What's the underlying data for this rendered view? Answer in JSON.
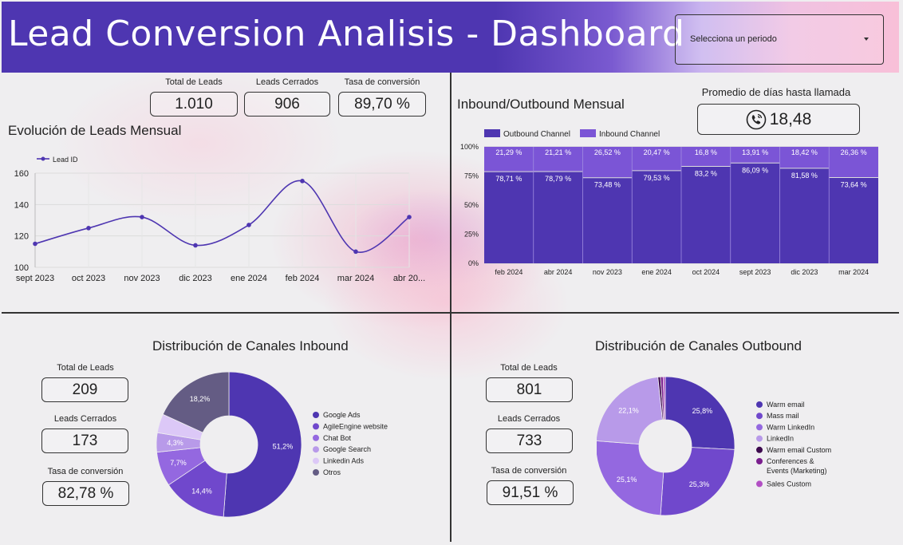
{
  "header": {
    "title": "Lead Conversion Analisis - Dashboard"
  },
  "period_select": {
    "placeholder": "Selecciona un periodo"
  },
  "top_kpis": [
    {
      "label": "Total de Leads",
      "value": "1.010"
    },
    {
      "label": "Leads Cerrados",
      "value": "906"
    },
    {
      "label": "Tasa de conversión",
      "value": "89,70 %"
    }
  ],
  "avg_days": {
    "label": "Promedio de días hasta llamada",
    "value": "18,48",
    "icon": "phone-call-icon"
  },
  "inbound_kpis": [
    {
      "label": "Total de Leads",
      "value": "209"
    },
    {
      "label": "Leads Cerrados",
      "value": "173"
    },
    {
      "label": "Tasa de conversión",
      "value": "82,78 %"
    }
  ],
  "outbound_kpis": [
    {
      "label": "Total de Leads",
      "value": "801"
    },
    {
      "label": "Leads Cerrados",
      "value": "733"
    },
    {
      "label": "Tasa de conversión",
      "value": "91,51 %"
    }
  ],
  "colors": {
    "header": "#4e36b1",
    "outbound": "#4e36b1",
    "inbound": "#7b55d6"
  },
  "chart_data": [
    {
      "id": "leads-line",
      "type": "line",
      "title": "Evolución de Leads Mensual",
      "x": [
        "sept 2023",
        "oct 2023",
        "nov 2023",
        "dic 2023",
        "ene 2024",
        "feb 2024",
        "mar 2024",
        "abr 20..."
      ],
      "series": [
        {
          "name": "Lead ID",
          "values": [
            115,
            125,
            132,
            114,
            127,
            155,
            110,
            132
          ],
          "color": "#4e36b1"
        }
      ],
      "ylim": [
        100,
        160
      ],
      "yticks": [
        100,
        120,
        140,
        160
      ],
      "grid": true,
      "legend": "top-left"
    },
    {
      "id": "io-bar",
      "type": "bar",
      "stacked": "percent",
      "title": "Inbound/Outbound Mensual",
      "categories": [
        "feb 2024",
        "abr 2024",
        "nov 2023",
        "ene 2024",
        "oct 2024",
        "sept 2023",
        "dic 2023",
        "mar 2024"
      ],
      "series": [
        {
          "name": "Outbound Channel",
          "values": [
            78.71,
            78.79,
            73.48,
            79.53,
            83.2,
            86.09,
            81.58,
            73.64
          ],
          "labels": [
            "78,71 %",
            "78,79 %",
            "73,48 %",
            "79,53 %",
            "83,2 %",
            "86,09 %",
            "81,58 %",
            "73,64 %"
          ],
          "color": "#4e36b1"
        },
        {
          "name": "Inbound Channel",
          "values": [
            21.29,
            21.21,
            26.52,
            20.47,
            16.8,
            13.91,
            18.42,
            26.36
          ],
          "labels": [
            "21,29 %",
            "21,21 %",
            "26,52 %",
            "20,47 %",
            "16,8 %",
            "13,91 %",
            "18,42 %",
            "26,36 %"
          ],
          "color": "#7b55d6"
        }
      ],
      "yticks": [
        "0%",
        "25%",
        "50%",
        "75%",
        "100%"
      ],
      "legend": "top-left"
    },
    {
      "id": "inbound-donut",
      "type": "pie",
      "donut": true,
      "title": "Distribución de Canales Inbound",
      "slices": [
        {
          "name": "Google Ads",
          "value": 51.2,
          "label": "51,2%",
          "color": "#4e36b1"
        },
        {
          "name": "AgileEngine website",
          "value": 14.4,
          "label": "14,4%",
          "color": "#7048cc"
        },
        {
          "name": "Chat Bot",
          "value": 7.7,
          "label": "7,7%",
          "color": "#9468e0"
        },
        {
          "name": "Google Search",
          "value": 4.3,
          "label": "4,3%",
          "color": "#b89ae9"
        },
        {
          "name": "Linkedin Ads",
          "value": 4.2,
          "label": "",
          "color": "#dcc8f7"
        },
        {
          "name": "Otros",
          "value": 18.2,
          "label": "18,2%",
          "color": "#645c84"
        }
      ],
      "legend": "right"
    },
    {
      "id": "outbound-donut",
      "type": "pie",
      "donut": true,
      "title": "Distribución de Canales Outbound",
      "slices": [
        {
          "name": "Warm email",
          "value": 25.8,
          "label": "25,8%",
          "color": "#4e36b1"
        },
        {
          "name": "Mass mail",
          "value": 25.3,
          "label": "25,3%",
          "color": "#7048cc"
        },
        {
          "name": "Warm LinkedIn",
          "value": 25.1,
          "label": "25,1%",
          "color": "#9468e0"
        },
        {
          "name": "LinkedIn",
          "value": 22.1,
          "label": "22,1%",
          "color": "#b89ae9"
        },
        {
          "name": "Warm email Custom",
          "value": 0.6,
          "label": "",
          "color": "#3d0a4e"
        },
        {
          "name": "Conferences & Events (Marketing)",
          "value": 0.6,
          "label": "",
          "color": "#7a1e8e"
        },
        {
          "name": "Sales Custom",
          "value": 0.5,
          "label": "",
          "color": "#b24fc4"
        }
      ],
      "legend": "right"
    }
  ]
}
